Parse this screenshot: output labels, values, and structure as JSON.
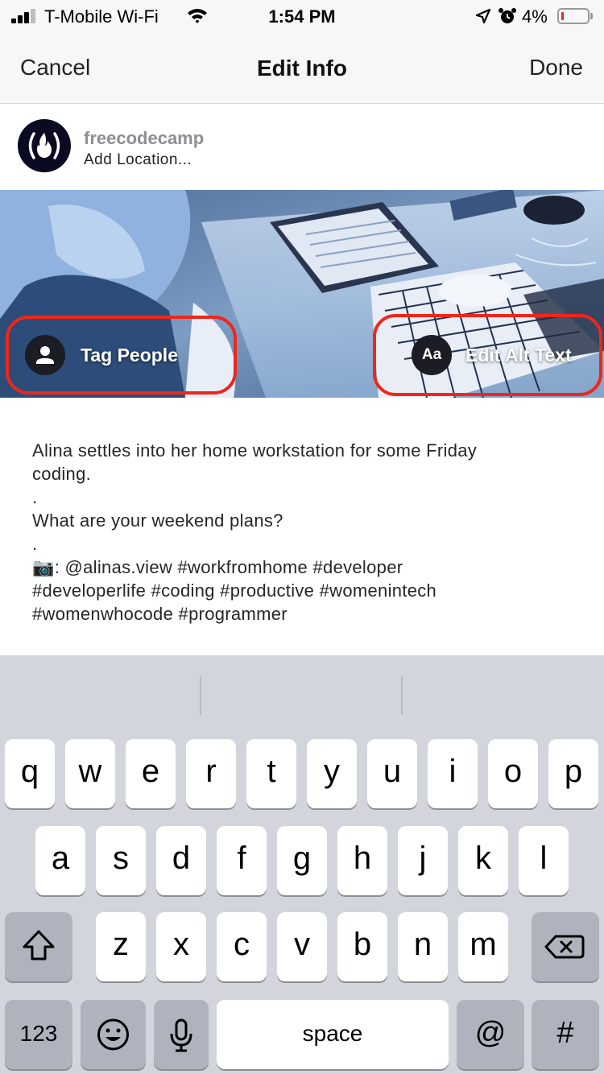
{
  "status_bar": {
    "carrier": "T-Mobile Wi-Fi",
    "time": "1:54 PM",
    "battery_percent": "4%",
    "battery_level": 0.04,
    "icons": [
      "signal-icon",
      "wifi-icon",
      "location-arrow-icon",
      "alarm-icon",
      "battery-icon"
    ]
  },
  "nav": {
    "cancel_label": "Cancel",
    "title": "Edit Info",
    "done_label": "Done"
  },
  "account": {
    "username": "freecodecamp",
    "add_location": "Add Location...",
    "avatar_icon": "freecodecamp-flame-logo"
  },
  "photo": {
    "tag_people_label": "Tag People",
    "alt_text_icon_label": "Aa",
    "edit_alt_text_label": "Edit Alt Text",
    "highlight_color": "#f0261a"
  },
  "caption": {
    "lines": [
      "Alina settles into her home workstation for some Friday",
      "coding.",
      ".",
      "What are your weekend plans?",
      ".",
      "📷: @alinas.view #workfromhome #developer",
      "#developerlife #coding #productive #womenintech",
      "#womenwhocode #programmer"
    ]
  },
  "keyboard": {
    "row1": [
      "q",
      "w",
      "e",
      "r",
      "t",
      "y",
      "u",
      "i",
      "o",
      "p"
    ],
    "row2": [
      "a",
      "s",
      "d",
      "f",
      "g",
      "h",
      "j",
      "k",
      "l"
    ],
    "row3": [
      "z",
      "x",
      "c",
      "v",
      "b",
      "n",
      "m"
    ],
    "numbers_label": "123",
    "space_label": "space",
    "at_label": "@",
    "hash_label": "#",
    "icons": [
      "shift-icon",
      "backspace-icon",
      "emoji-icon",
      "microphone-icon"
    ]
  }
}
